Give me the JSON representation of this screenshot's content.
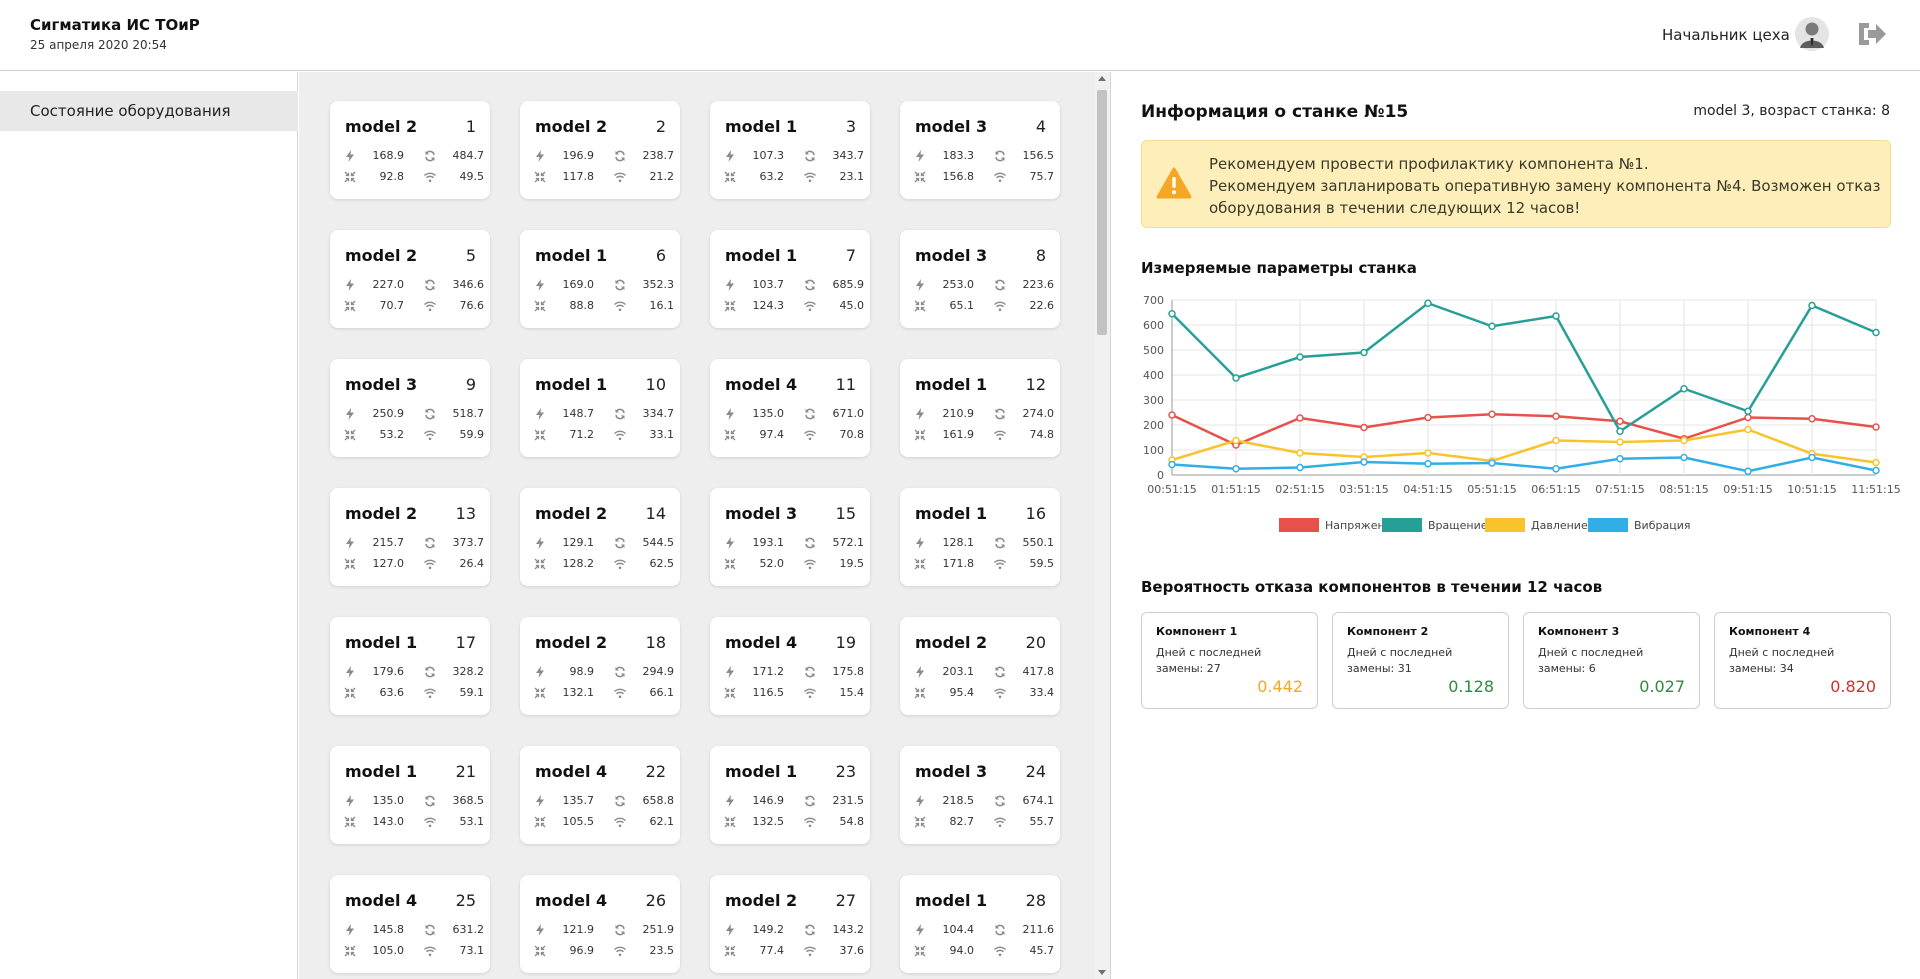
{
  "header": {
    "app_title": "Сигматика ИС ТОиР",
    "date": "25 апреля 2020 20:54",
    "user_role": "Начальник цеха",
    "avatar_icon": "user-avatar-icon",
    "logout_icon": "logout-icon"
  },
  "sidebar": {
    "items": [
      {
        "label": "Состояние оборудования",
        "active": true
      }
    ]
  },
  "metric_icons": {
    "voltage": "lightning-icon",
    "rotation": "refresh-icon",
    "pressure": "compress-icon",
    "vibration": "wifi-icon"
  },
  "machines": [
    {
      "model": "model 2",
      "num": "1",
      "voltage": "168.9",
      "rotation": "484.7",
      "pressure": "92.8",
      "vibration": "49.5"
    },
    {
      "model": "model 2",
      "num": "2",
      "voltage": "196.9",
      "rotation": "238.7",
      "pressure": "117.8",
      "vibration": "21.2"
    },
    {
      "model": "model 1",
      "num": "3",
      "voltage": "107.3",
      "rotation": "343.7",
      "pressure": "63.2",
      "vibration": "23.1"
    },
    {
      "model": "model 3",
      "num": "4",
      "voltage": "183.3",
      "rotation": "156.5",
      "pressure": "156.8",
      "vibration": "75.7"
    },
    {
      "model": "model 2",
      "num": "5",
      "voltage": "227.0",
      "rotation": "346.6",
      "pressure": "70.7",
      "vibration": "76.6"
    },
    {
      "model": "model 1",
      "num": "6",
      "voltage": "169.0",
      "rotation": "352.3",
      "pressure": "88.8",
      "vibration": "16.1"
    },
    {
      "model": "model 1",
      "num": "7",
      "voltage": "103.7",
      "rotation": "685.9",
      "pressure": "124.3",
      "vibration": "45.0"
    },
    {
      "model": "model 3",
      "num": "8",
      "voltage": "253.0",
      "rotation": "223.6",
      "pressure": "65.1",
      "vibration": "22.6"
    },
    {
      "model": "model 3",
      "num": "9",
      "voltage": "250.9",
      "rotation": "518.7",
      "pressure": "53.2",
      "vibration": "59.9"
    },
    {
      "model": "model 1",
      "num": "10",
      "voltage": "148.7",
      "rotation": "334.7",
      "pressure": "71.2",
      "vibration": "33.1"
    },
    {
      "model": "model 4",
      "num": "11",
      "voltage": "135.0",
      "rotation": "671.0",
      "pressure": "97.4",
      "vibration": "70.8"
    },
    {
      "model": "model 1",
      "num": "12",
      "voltage": "210.9",
      "rotation": "274.0",
      "pressure": "161.9",
      "vibration": "74.8"
    },
    {
      "model": "model 2",
      "num": "13",
      "voltage": "215.7",
      "rotation": "373.7",
      "pressure": "127.0",
      "vibration": "26.4"
    },
    {
      "model": "model 2",
      "num": "14",
      "voltage": "129.1",
      "rotation": "544.5",
      "pressure": "128.2",
      "vibration": "62.5"
    },
    {
      "model": "model 3",
      "num": "15",
      "voltage": "193.1",
      "rotation": "572.1",
      "pressure": "52.0",
      "vibration": "19.5"
    },
    {
      "model": "model 1",
      "num": "16",
      "voltage": "128.1",
      "rotation": "550.1",
      "pressure": "171.8",
      "vibration": "59.5"
    },
    {
      "model": "model 1",
      "num": "17",
      "voltage": "179.6",
      "rotation": "328.2",
      "pressure": "63.6",
      "vibration": "59.1"
    },
    {
      "model": "model 2",
      "num": "18",
      "voltage": "98.9",
      "rotation": "294.9",
      "pressure": "132.1",
      "vibration": "66.1"
    },
    {
      "model": "model 4",
      "num": "19",
      "voltage": "171.2",
      "rotation": "175.8",
      "pressure": "116.5",
      "vibration": "15.4"
    },
    {
      "model": "model 2",
      "num": "20",
      "voltage": "203.1",
      "rotation": "417.8",
      "pressure": "95.4",
      "vibration": "33.4"
    },
    {
      "model": "model 1",
      "num": "21",
      "voltage": "135.0",
      "rotation": "368.5",
      "pressure": "143.0",
      "vibration": "53.1"
    },
    {
      "model": "model 4",
      "num": "22",
      "voltage": "135.7",
      "rotation": "658.8",
      "pressure": "105.5",
      "vibration": "62.1"
    },
    {
      "model": "model 1",
      "num": "23",
      "voltage": "146.9",
      "rotation": "231.5",
      "pressure": "132.5",
      "vibration": "54.8"
    },
    {
      "model": "model 3",
      "num": "24",
      "voltage": "218.5",
      "rotation": "674.1",
      "pressure": "82.7",
      "vibration": "55.7"
    },
    {
      "model": "model 4",
      "num": "25",
      "voltage": "145.8",
      "rotation": "631.2",
      "pressure": "105.0",
      "vibration": "73.1"
    },
    {
      "model": "model 4",
      "num": "26",
      "voltage": "121.9",
      "rotation": "251.9",
      "pressure": "96.9",
      "vibration": "23.5"
    },
    {
      "model": "model 2",
      "num": "27",
      "voltage": "149.2",
      "rotation": "143.2",
      "pressure": "77.4",
      "vibration": "37.6"
    },
    {
      "model": "model 1",
      "num": "28",
      "voltage": "104.4",
      "rotation": "211.6",
      "pressure": "94.0",
      "vibration": "45.7"
    }
  ],
  "panel": {
    "title": "Информация о станке №15",
    "meta": "model 3, возраст станка: 8",
    "alert_icon": "warning-icon",
    "alert_color": "#f5a623",
    "alert_lines": [
      "Рекомендуем провести профилактику компонента №1.",
      "Рекомендуем запланировать оперативную замену компонента №4. Возможен отказ",
      "оборудования в течении следующих 12 часов!"
    ],
    "chart_title": "Измеряемые параметры станка",
    "components_title": "Вероятность отказа компонентов в течении 12 часов",
    "components": [
      {
        "name": "Компонент 1",
        "text_1": "Дней с последней",
        "text_2": "замены: 27",
        "prob": "0.442",
        "color": "#f5a623"
      },
      {
        "name": "Компонент 2",
        "text_1": "Дней с последней",
        "text_2": "замены: 31",
        "prob": "0.128",
        "color": "#2e8b3e"
      },
      {
        "name": "Компонент 3",
        "text_1": "Дней с последней",
        "text_2": "замены: 6",
        "prob": "0.027",
        "color": "#2e8b3e"
      },
      {
        "name": "Компонент 4",
        "text_1": "Дней с последней",
        "text_2": "замены: 34",
        "prob": "0.820",
        "color": "#d0312d"
      }
    ]
  },
  "chart_data": {
    "type": "line",
    "x": [
      "00:51:15",
      "01:51:15",
      "02:51:15",
      "03:51:15",
      "04:51:15",
      "05:51:15",
      "06:51:15",
      "07:51:15",
      "08:51:15",
      "09:51:15",
      "10:51:15",
      "11:51:15"
    ],
    "ylim": [
      0,
      700
    ],
    "yticks": [
      "0",
      "100",
      "200",
      "300",
      "400",
      "500",
      "600",
      "700"
    ],
    "grid": true,
    "legend_position": "bottom",
    "series": [
      {
        "name": "Напряжение",
        "color": "#e8504a",
        "values": [
          240,
          120,
          228,
          190,
          230,
          243,
          235,
          215,
          145,
          230,
          225,
          192
        ]
      },
      {
        "name": "Вращение",
        "color": "#26a096",
        "values": [
          645,
          388,
          472,
          490,
          687,
          595,
          636,
          175,
          345,
          255,
          678,
          570
        ]
      },
      {
        "name": "Давление",
        "color": "#f9c32b",
        "values": [
          60,
          138,
          88,
          72,
          88,
          56,
          138,
          132,
          138,
          182,
          85,
          50
        ]
      },
      {
        "name": "Вибрация",
        "color": "#31aee6",
        "values": [
          42,
          25,
          30,
          52,
          45,
          48,
          25,
          65,
          70,
          15,
          70,
          18
        ]
      }
    ]
  }
}
